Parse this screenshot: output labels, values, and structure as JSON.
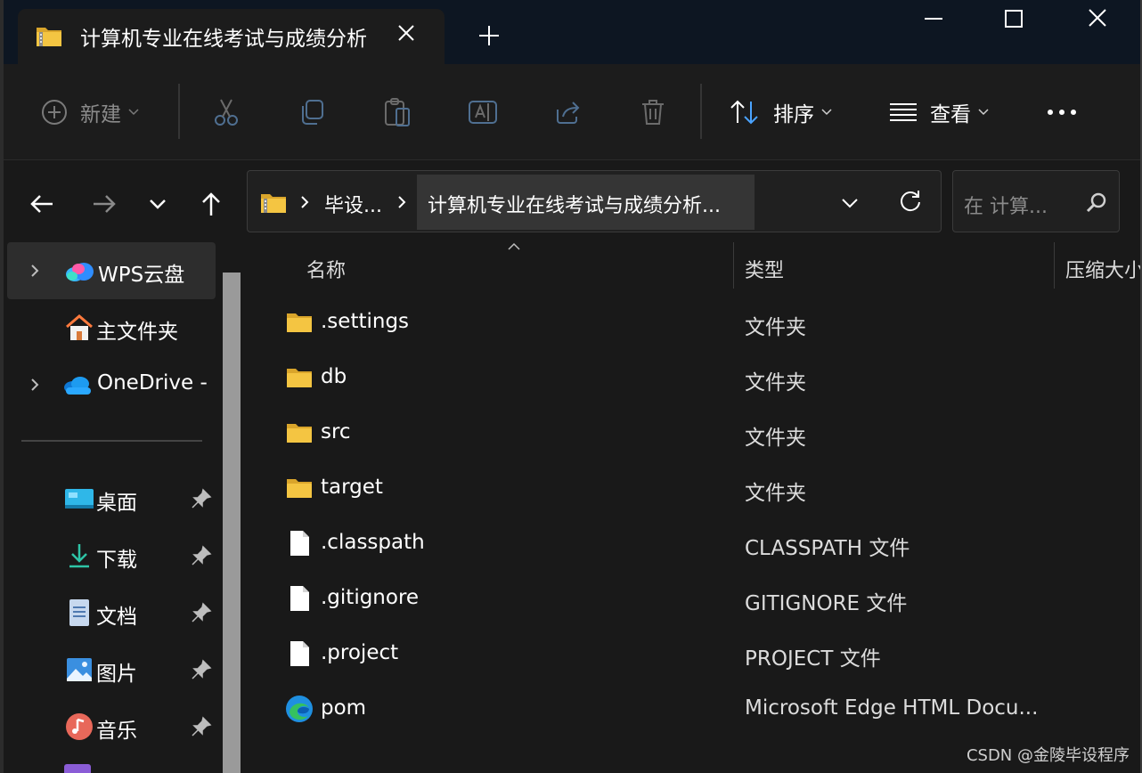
{
  "tab": {
    "title": "计算机专业在线考试与成绩分析"
  },
  "window_controls": {
    "minimize": "minimize",
    "maximize": "maximize",
    "close": "close"
  },
  "command_bar": {
    "new_label": "新建",
    "sort_label": "排序",
    "view_label": "查看"
  },
  "address": {
    "crumbs": [
      "毕设...",
      "计算机专业在线考试与成绩分析..."
    ]
  },
  "search": {
    "placeholder": "在 计算..."
  },
  "sidebar": {
    "items": [
      {
        "label": "WPS云盘",
        "icon": "wps-cloud-icon",
        "expandable": true,
        "selected": true
      },
      {
        "label": "主文件夹",
        "icon": "home-icon",
        "expandable": false
      },
      {
        "label": "OneDrive -",
        "icon": "onedrive-icon",
        "expandable": true
      },
      {
        "label": "桌面",
        "icon": "desktop-icon",
        "pinned": true
      },
      {
        "label": "下载",
        "icon": "download-icon",
        "pinned": true
      },
      {
        "label": "文档",
        "icon": "documents-icon",
        "pinned": true
      },
      {
        "label": "图片",
        "icon": "pictures-icon",
        "pinned": true
      },
      {
        "label": "音乐",
        "icon": "music-icon",
        "pinned": true
      }
    ]
  },
  "file_list": {
    "columns": [
      "名称",
      "类型",
      "压缩大小"
    ],
    "rows": [
      {
        "name": ".settings",
        "type": "文件夹",
        "icon": "folder-icon"
      },
      {
        "name": "db",
        "type": "文件夹",
        "icon": "folder-icon"
      },
      {
        "name": "src",
        "type": "文件夹",
        "icon": "folder-icon"
      },
      {
        "name": "target",
        "type": "文件夹",
        "icon": "folder-icon"
      },
      {
        "name": ".classpath",
        "type": "CLASSPATH 文件",
        "icon": "file-icon"
      },
      {
        "name": ".gitignore",
        "type": "GITIGNORE 文件",
        "icon": "file-icon"
      },
      {
        "name": ".project",
        "type": "PROJECT 文件",
        "icon": "file-icon"
      },
      {
        "name": "pom",
        "type": "Microsoft Edge HTML Docu...",
        "icon": "edge-icon"
      }
    ]
  },
  "watermark": "CSDN @金陵毕设程序",
  "colors": {
    "titlebar_bg": "#0d1622",
    "window_bg": "#191919",
    "folder_yellow": "#f4c542",
    "accent_blue": "#4aa3ff"
  }
}
